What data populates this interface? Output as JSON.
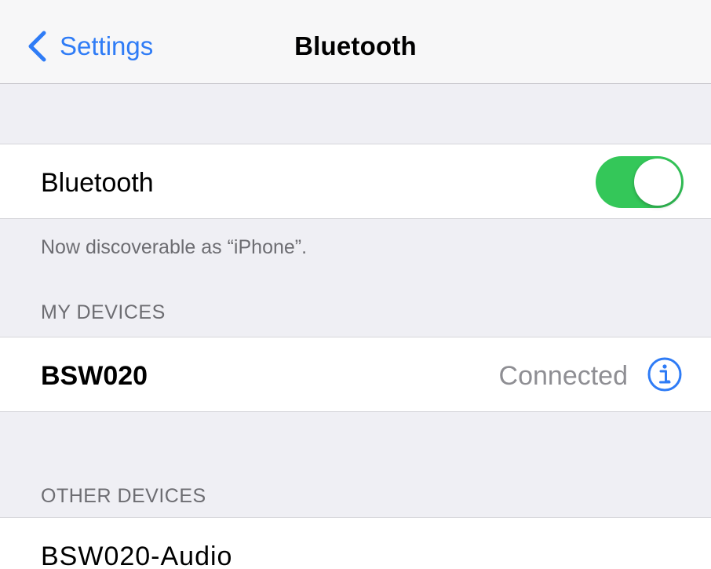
{
  "navbar": {
    "back_label": "Settings",
    "title": "Bluetooth"
  },
  "bluetooth_toggle": {
    "label": "Bluetooth",
    "state": "on",
    "accent_color": "#34c759"
  },
  "discoverable_note": "Now discoverable as “iPhone”.",
  "my_devices": {
    "header": "MY DEVICES",
    "items": [
      {
        "name": "BSW020",
        "status": "Connected",
        "icon": "info-icon"
      }
    ]
  },
  "other_devices": {
    "header": "OTHER DEVICES",
    "items": [
      {
        "name": "BSW020-Audio"
      }
    ]
  },
  "colors": {
    "link": "#2f7cf6",
    "background": "#efeff4",
    "secondary_text": "#6d6d72"
  }
}
